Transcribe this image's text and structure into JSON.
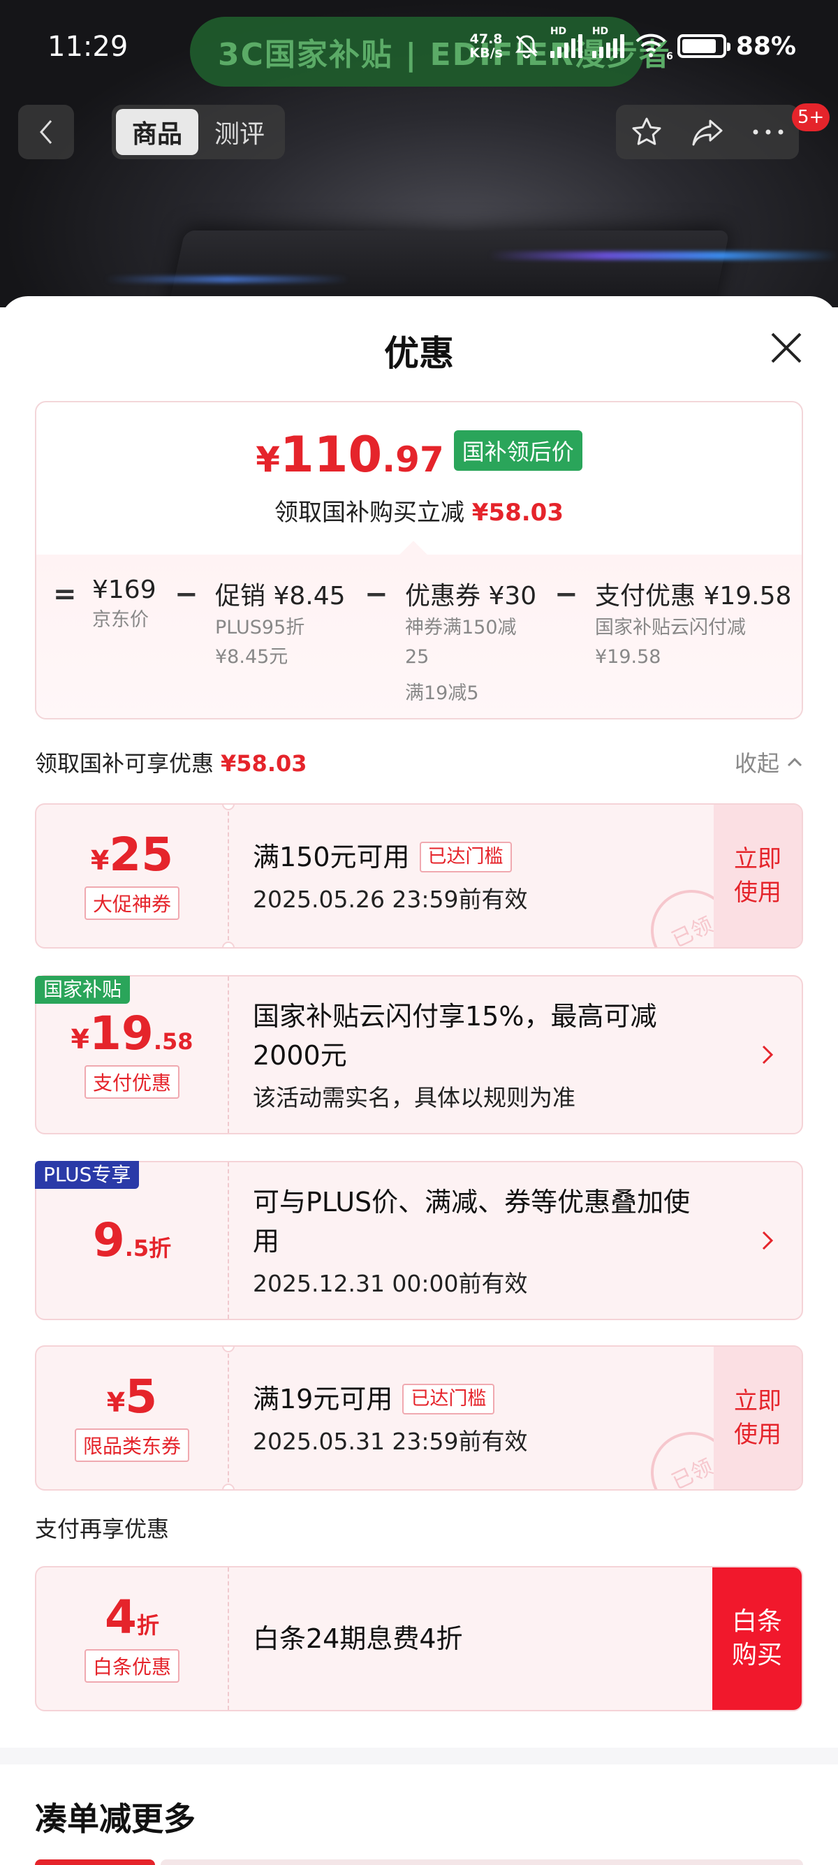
{
  "status_bar": {
    "time": "11:29",
    "banner_text": "3C国家补贴 | EDIFIER漫步者",
    "net_speed_value": "47.8",
    "net_speed_unit": "KB/s",
    "hd_label": "HD",
    "wifi_label": "6",
    "battery_percent": "88%"
  },
  "nav": {
    "tabs": [
      {
        "label": "商品",
        "active": true
      },
      {
        "label": "测评",
        "active": false
      }
    ],
    "message_badge": "5+"
  },
  "sheet": {
    "title": "优惠",
    "price_summary": {
      "currency": "¥",
      "price_int": "110",
      "price_dec": ".97",
      "badge": "国补领后价",
      "subtitle": "领取国补购买立减",
      "subtitle_amount": "¥58.03",
      "breakdown": {
        "op_equals": "=",
        "op_minus": "−",
        "items": [
          {
            "head": "¥169",
            "notes": [
              "京东价"
            ],
            "extra": ""
          },
          {
            "head": "促销 ¥8.45",
            "notes": [
              "PLUS95折",
              "¥8.45元"
            ],
            "extra": ""
          },
          {
            "head": "优惠券 ¥30",
            "notes": [
              "神券满150减",
              "25"
            ],
            "extra": "满19减5"
          },
          {
            "head": "支付优惠 ¥19.58",
            "notes": [
              "国家补贴云闪付减",
              "¥19.58"
            ],
            "extra": ""
          }
        ]
      }
    },
    "section1": {
      "label": "领取国补可享优惠",
      "amount": "¥58.03",
      "collapse": "收起"
    },
    "coupons": [
      {
        "corner": "",
        "yen": "¥",
        "num": "25",
        "suffix": "",
        "tag": "大促神券",
        "title": "满150元可用",
        "reached": "已达门槛",
        "sub": "2025.05.26 23:59前有效",
        "action": "立即使用",
        "stamp": "已领"
      },
      {
        "corner": "国家补贴",
        "yen": "¥",
        "num": "19",
        "suffix": ".58",
        "tag": "支付优惠",
        "title": "国家补贴云闪付享15%，最高可减2000元",
        "sub": "该活动需实名，具体以规则为准"
      },
      {
        "corner": "PLUS专享",
        "yen": "",
        "num": "9",
        "suffix": ".5折",
        "tag": "",
        "title": "可与PLUS价、满减、券等优惠叠加使用",
        "sub": "2025.12.31 00:00前有效"
      },
      {
        "corner": "",
        "yen": "¥",
        "num": "5",
        "suffix": "",
        "tag": "限品类东券",
        "title": "满19元可用",
        "reached": "已达门槛",
        "sub": "2025.05.31 23:59前有效",
        "action": "立即使用",
        "stamp": "已领"
      }
    ],
    "section2": {
      "label": "支付再享优惠"
    },
    "pay_offer": {
      "num": "4",
      "suffix": "折",
      "tag": "白条优惠",
      "title": "白条24期息费4折",
      "action": "白条购买"
    },
    "more_title": "凑单减更多"
  },
  "colors": {
    "accent_red": "#e5242b",
    "green_badge": "#2aa55a",
    "plus_blue": "#2a3aa8",
    "coupon_bg": "#fdf2f3"
  }
}
